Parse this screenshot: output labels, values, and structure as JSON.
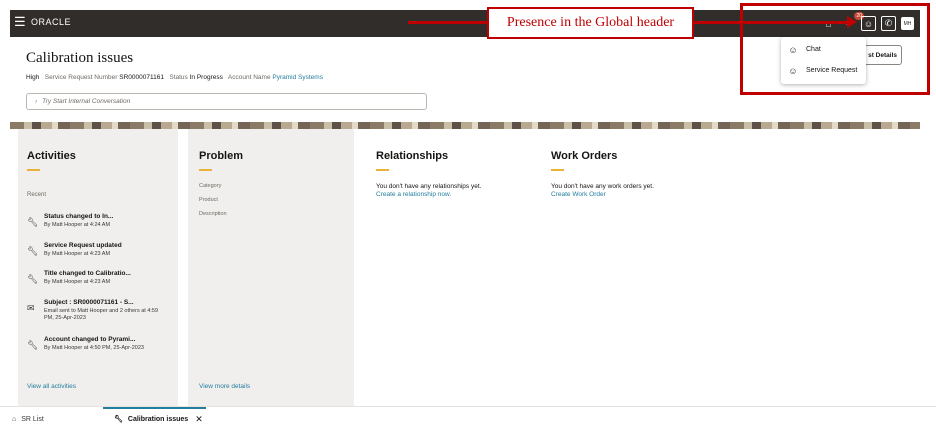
{
  "header": {
    "brand": "ORACLE",
    "notification_count": "20",
    "avatar_initials": "MH"
  },
  "annotation": {
    "text": "Presence in the Global header"
  },
  "presence_menu": {
    "items": [
      {
        "label": "Chat",
        "icon": "person-icon"
      },
      {
        "label": "Service Request",
        "icon": "person-icon"
      }
    ]
  },
  "actions": {
    "details_label": "st Details"
  },
  "title": "Calibration issues",
  "meta": {
    "priority": "High",
    "sr_label": "Service Request Number",
    "sr_number": "SR0000071161",
    "status_label": "Status",
    "status": "In Progress",
    "account_label": "Account Name",
    "account": "Pyramid Systems"
  },
  "conversation": {
    "placeholder": "Try Start Internal Conversation"
  },
  "activities": {
    "title": "Activities",
    "recent_label": "Recent",
    "items": [
      {
        "title": "Status changed to In...",
        "sub": "By Matt Hooper at 4:24 AM",
        "icon": "wrench-icon"
      },
      {
        "title": "Service Request updated",
        "sub": "By Matt Hooper at 4:23 AM",
        "icon": "wrench-icon"
      },
      {
        "title": "Title changed to Calibratio...",
        "sub": "By Matt Hooper at 4:23 AM",
        "icon": "wrench-icon"
      },
      {
        "title": "Subject : SR0000071161 - S...",
        "sub": "Email sent to Matt Hooper and 2 others at 4:59 PM, 25-Apr-2023",
        "icon": "mail-icon"
      },
      {
        "title": "Account changed to Pyrami...",
        "sub": "By Matt Hooper at 4:50 PM, 25-Apr-2023",
        "icon": "wrench-icon"
      }
    ],
    "view_all": "View all activities"
  },
  "problem": {
    "title": "Problem",
    "fields": [
      "Category",
      "Product",
      "Description"
    ],
    "view_more": "View more details"
  },
  "relationships": {
    "title": "Relationships",
    "empty": "You don't have any relationships yet.",
    "action": "Create a relationship now."
  },
  "work_orders": {
    "title": "Work Orders",
    "empty": "You don't have any work orders yet.",
    "action": "Create Work Order"
  },
  "tabs": [
    {
      "label": "SR List",
      "icon": "home-icon"
    },
    {
      "label": "Calibration issues",
      "icon": "wrench-icon"
    }
  ],
  "colors": {
    "header_bg": "#312d2a",
    "link": "#227e9e",
    "accent": "#e9b23b",
    "annotation": "#c00000"
  }
}
